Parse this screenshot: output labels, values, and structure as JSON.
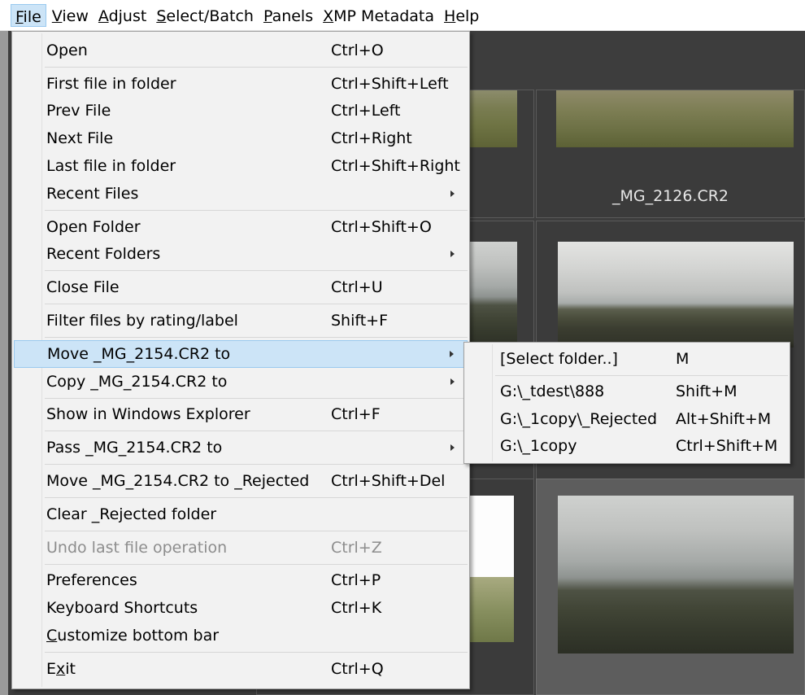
{
  "menubar": {
    "items": [
      {
        "pre": "",
        "mn": "F",
        "post": "ile"
      },
      {
        "pre": "",
        "mn": "V",
        "post": "iew"
      },
      {
        "pre": "",
        "mn": "A",
        "post": "djust"
      },
      {
        "pre": "",
        "mn": "S",
        "post": "elect/Batch"
      },
      {
        "pre": "",
        "mn": "P",
        "post": "anels"
      },
      {
        "pre": "",
        "mn": "X",
        "post": "MP Metadata"
      },
      {
        "pre": "",
        "mn": "H",
        "post": "elp"
      }
    ]
  },
  "grid": {
    "labels": {
      "top_right": "_MG_2126.CR2"
    }
  },
  "file_menu": {
    "open": {
      "label": "Open",
      "shortcut": "Ctrl+O"
    },
    "first_file": {
      "label": "First file in folder",
      "shortcut": "Ctrl+Shift+Left"
    },
    "prev_file": {
      "label": "Prev File",
      "shortcut": "Ctrl+Left"
    },
    "next_file": {
      "label": "Next File",
      "shortcut": "Ctrl+Right"
    },
    "last_file": {
      "label": "Last file in folder",
      "shortcut": "Ctrl+Shift+Right"
    },
    "recent_files": {
      "label": "Recent Files"
    },
    "open_folder": {
      "label": "Open Folder",
      "shortcut": "Ctrl+Shift+O"
    },
    "recent_folders": {
      "label": "Recent Folders"
    },
    "close_file": {
      "label": "Close File",
      "shortcut": "Ctrl+U"
    },
    "filter_files": {
      "label": "Filter files by rating/label",
      "shortcut": "Shift+F"
    },
    "move_to": {
      "label": "Move _MG_2154.CR2 to"
    },
    "copy_to": {
      "label": "Copy _MG_2154.CR2 to"
    },
    "show_explorer": {
      "label": "Show in Windows Explorer",
      "shortcut": "Ctrl+F"
    },
    "pass_to": {
      "label": "Pass _MG_2154.CR2 to"
    },
    "move_rejected": {
      "label": "Move _MG_2154.CR2 to _Rejected",
      "shortcut": "Ctrl+Shift+Del"
    },
    "clear_rejected": {
      "label": "Clear _Rejected folder"
    },
    "undo": {
      "label": "Undo last file operation",
      "shortcut": "Ctrl+Z"
    },
    "preferences": {
      "label": "Preferences",
      "shortcut": "Ctrl+P"
    },
    "keyboard_shortcuts": {
      "label": "Keyboard Shortcuts",
      "shortcut": "Ctrl+K"
    },
    "customize_bar": {
      "mn": "C",
      "rest": "ustomize bottom bar"
    },
    "exit": {
      "pre": "E",
      "mn": "x",
      "rest": "it",
      "shortcut": "Ctrl+Q"
    }
  },
  "move_submenu": {
    "select_folder": {
      "label": "[Select folder..]",
      "shortcut": "M"
    },
    "dest1": {
      "label": "G:\\_tdest\\888",
      "shortcut": "Shift+M"
    },
    "dest2": {
      "label": "G:\\_1copy\\_Rejected",
      "shortcut": "Alt+Shift+M"
    },
    "dest3": {
      "label": "G:\\_1copy",
      "shortcut": "Ctrl+Shift+M"
    }
  }
}
